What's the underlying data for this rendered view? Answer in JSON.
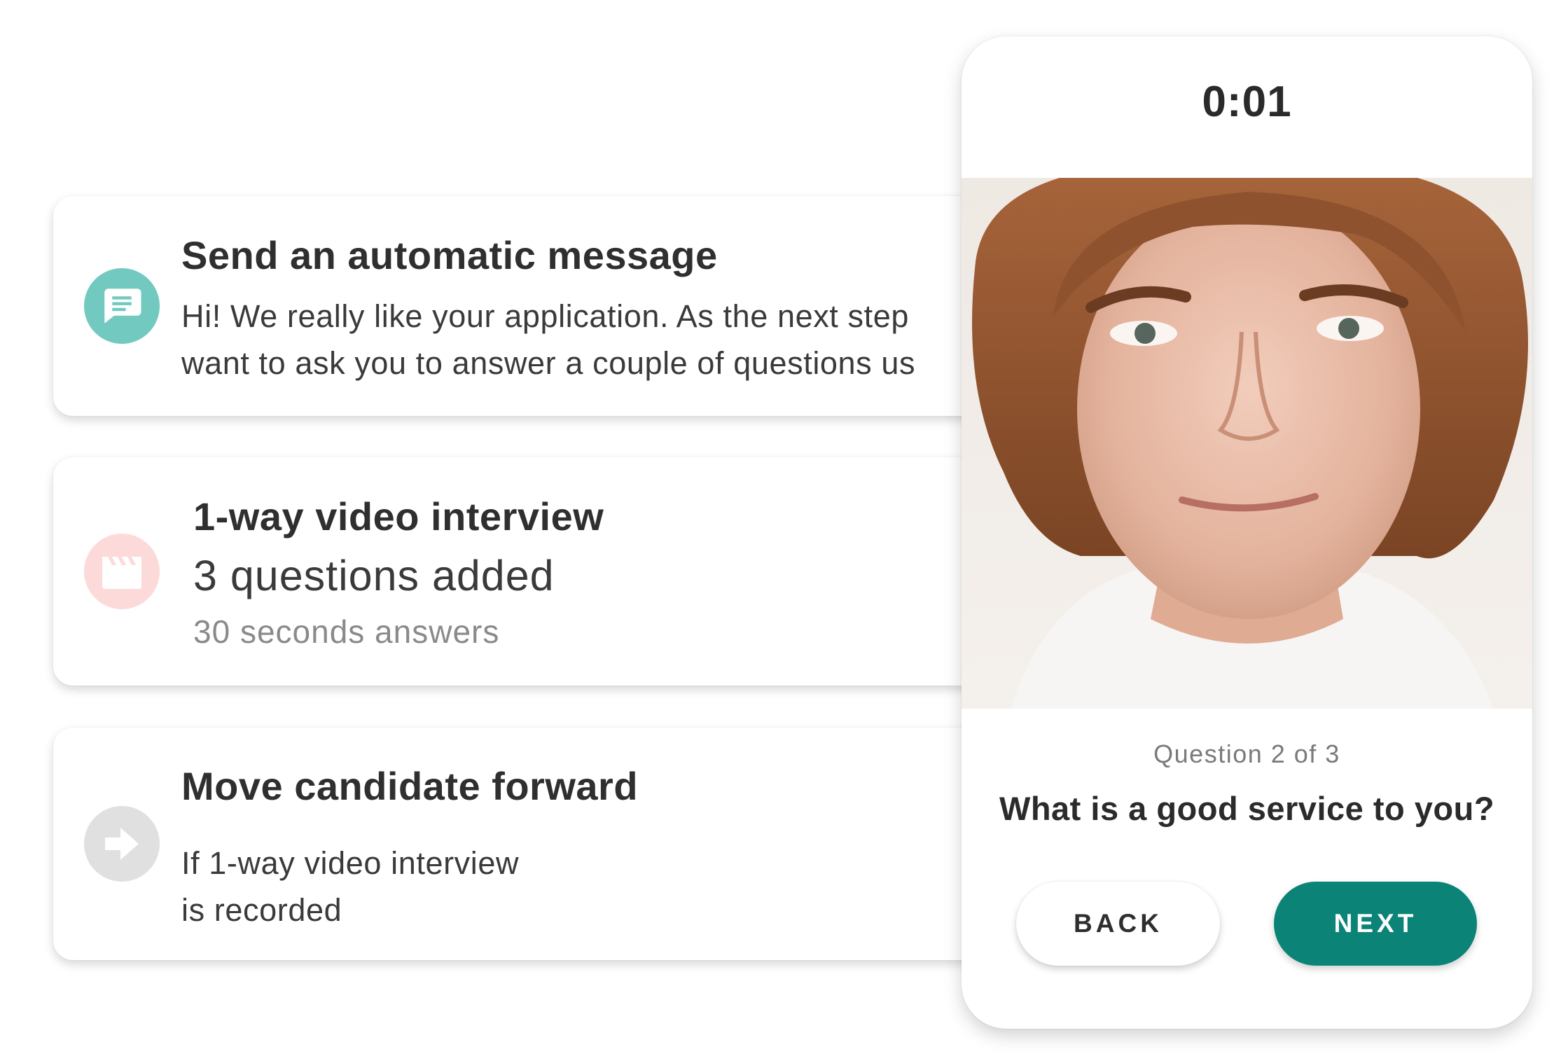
{
  "cards": {
    "message": {
      "title": "Send an automatic message",
      "line1": "Hi! We really like your application. As the next step",
      "line2": "want to ask you to answer a couple of questions us",
      "icon": "chat-message-icon"
    },
    "video": {
      "title": "1-way video interview",
      "questions": "3 questions added",
      "answers": "30 seconds answers",
      "icon": "video-clapperboard-icon"
    },
    "move": {
      "title": "Move candidate forward",
      "line1": "If 1-way video interview",
      "line2": "is recorded",
      "icon": "arrow-right-icon"
    }
  },
  "phone": {
    "timer": "0:01",
    "question_count": "Question 2 of 3",
    "question": "What is a good service to you?",
    "back_label": "BACK",
    "next_label": "NEXT"
  },
  "colors": {
    "accent_teal": "#0b8477",
    "message_icon_bg": "#72c9bf",
    "video_icon_bg": "#fddada",
    "move_icon_bg": "#e0e0e0"
  }
}
